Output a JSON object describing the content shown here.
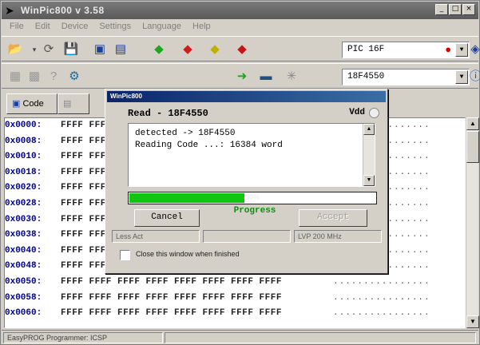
{
  "window": {
    "title": "WinPic800      v 3.58",
    "buttons": [
      "_",
      "□",
      "×"
    ]
  },
  "menu": [
    "File",
    "Edit",
    "Device",
    "Settings",
    "Language",
    "Help"
  ],
  "toolbar1": {
    "family_combo": "PIC 16F",
    "icons": [
      "open-folder-icon",
      "reload-icon",
      "save-icon",
      "device-view-icon",
      "config-icon",
      "read-chip-icon",
      "write-chip-icon",
      "verify-chip-icon",
      "erase-chip-icon"
    ]
  },
  "toolbar2": {
    "device_combo": "18F4550",
    "icons": [
      "chip-icon",
      "hardware-icon",
      "detect-icon",
      "stop-icon",
      "clock-icon",
      "lightning-icon",
      "help-icon",
      "info-icon"
    ]
  },
  "tabs": {
    "code": "Code"
  },
  "hex": {
    "rows": [
      {
        "addr": "0x0000:",
        "data": "FFFF FFFF FFFF FFFF FFFF FFFF FFFF FFFF",
        "ascii": "................"
      },
      {
        "addr": "0x0008:",
        "data": "FFFF FFFF FFFF FFFF FFFF FFFF FFFF FFFF",
        "ascii": "................"
      },
      {
        "addr": "0x0010:",
        "data": "FFFF FFFF FFFF FFFF FFFF FFFF FFFF FFFF",
        "ascii": "................"
      },
      {
        "addr": "0x0018:",
        "data": "FFFF FFFF FFFF FFFF FFFF FFFF FFFF FFFF",
        "ascii": "................"
      },
      {
        "addr": "0x0020:",
        "data": "FFFF FFFF FFFF FFFF FFFF FFFF FFFF FFFF",
        "ascii": "................"
      },
      {
        "addr": "0x0028:",
        "data": "FFFF FFFF FFFF FFFF FFFF FFFF FFFF FFFF",
        "ascii": "................"
      },
      {
        "addr": "0x0030:",
        "data": "FFFF FFFF FFFF FFFF FFFF FFFF FFFF FFFF",
        "ascii": "................"
      },
      {
        "addr": "0x0038:",
        "data": "FFFF FFFF FFFF FFFF FFFF FFFF FFFF FFFF",
        "ascii": "................"
      },
      {
        "addr": "0x0040:",
        "data": "FFFF FFFF FFFF FFFF FFFF FFFF FFFF FFFF",
        "ascii": "................"
      },
      {
        "addr": "0x0048:",
        "data": "FFFF FFFF FFFF FFFF FFFF FFFF FFFF FFFF",
        "ascii": "................"
      },
      {
        "addr": "0x0050:",
        "data": "FFFF FFFF FFFF FFFF FFFF FFFF FFFF FFFF",
        "ascii": "................"
      },
      {
        "addr": "0x0058:",
        "data": "FFFF FFFF FFFF FFFF FFFF FFFF FFFF FFFF",
        "ascii": "................"
      },
      {
        "addr": "0x0060:",
        "data": "FFFF FFFF FFFF FFFF FFFF FFFF FFFF FFFF",
        "ascii": "................"
      }
    ]
  },
  "status": {
    "text": "EasyPROG Programmer: ICSP"
  },
  "dialog": {
    "title": "WinPic800",
    "device": "Read - 18F4550",
    "voltage": "Vdd",
    "log": [
      "detected -> 18F4550",
      "Reading Code ...: 16384 word"
    ],
    "progress_value": 0.47,
    "progress_text": "50%",
    "progress_label": "Progress",
    "cancel": "Cancel",
    "accept": "Accept",
    "info_left": "Less Act",
    "info_mid": "",
    "info_right": "LVP 200 MHz",
    "close_when_finished": "Close this window when finished"
  }
}
